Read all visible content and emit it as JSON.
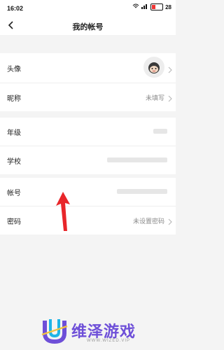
{
  "status_bar": {
    "time": "16:02",
    "battery_level": "28"
  },
  "header": {
    "title": "我的帐号"
  },
  "rows": {
    "avatar": {
      "label": "头像"
    },
    "nickname": {
      "label": "昵称",
      "value": "未填写"
    },
    "grade": {
      "label": "年级"
    },
    "school": {
      "label": "学校"
    },
    "account": {
      "label": "帐号"
    },
    "password": {
      "label": "密码",
      "value": "未设置密码"
    }
  },
  "watermark": {
    "title": "维泽游戏",
    "subtitle": "WWW.WIZED.VIP"
  },
  "colors": {
    "accent": "#6e4fd8",
    "annotation": "#e8262a",
    "page_bg": "#f4f4f4"
  }
}
